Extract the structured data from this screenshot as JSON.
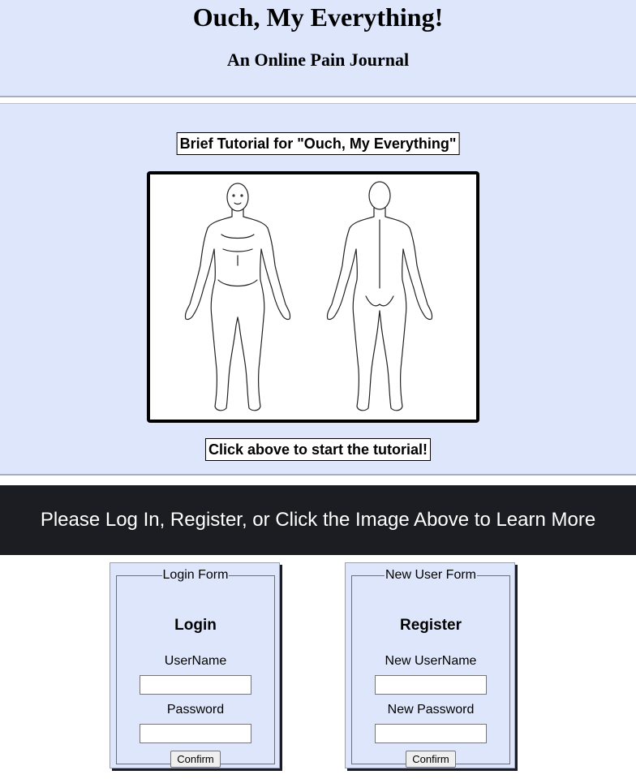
{
  "header": {
    "title": "Ouch, My Everything!",
    "subtitle": "An Online Pain Journal"
  },
  "tutorial": {
    "title": "Brief Tutorial for \"Ouch, My Everything\"",
    "image_description_icon": "body-diagram-icon",
    "hint": "Click above to start the tutorial!"
  },
  "banner": {
    "text": "Please Log In, Register, or Click the Image Above to Learn More"
  },
  "login_form": {
    "legend": "Login Form",
    "heading": "Login",
    "username_label": "UserName",
    "username_value": "",
    "password_label": "Password",
    "password_value": "",
    "confirm_label": "Confirm"
  },
  "register_form": {
    "legend": "New User Form",
    "heading": "Register",
    "username_label": "New UserName",
    "username_value": "",
    "password_label": "New Password",
    "password_value": "",
    "confirm_label": "Confirm"
  },
  "colors": {
    "section_bg": "#dde6fb",
    "banner_bg": "#1c1d22",
    "banner_text": "#ffffff"
  }
}
